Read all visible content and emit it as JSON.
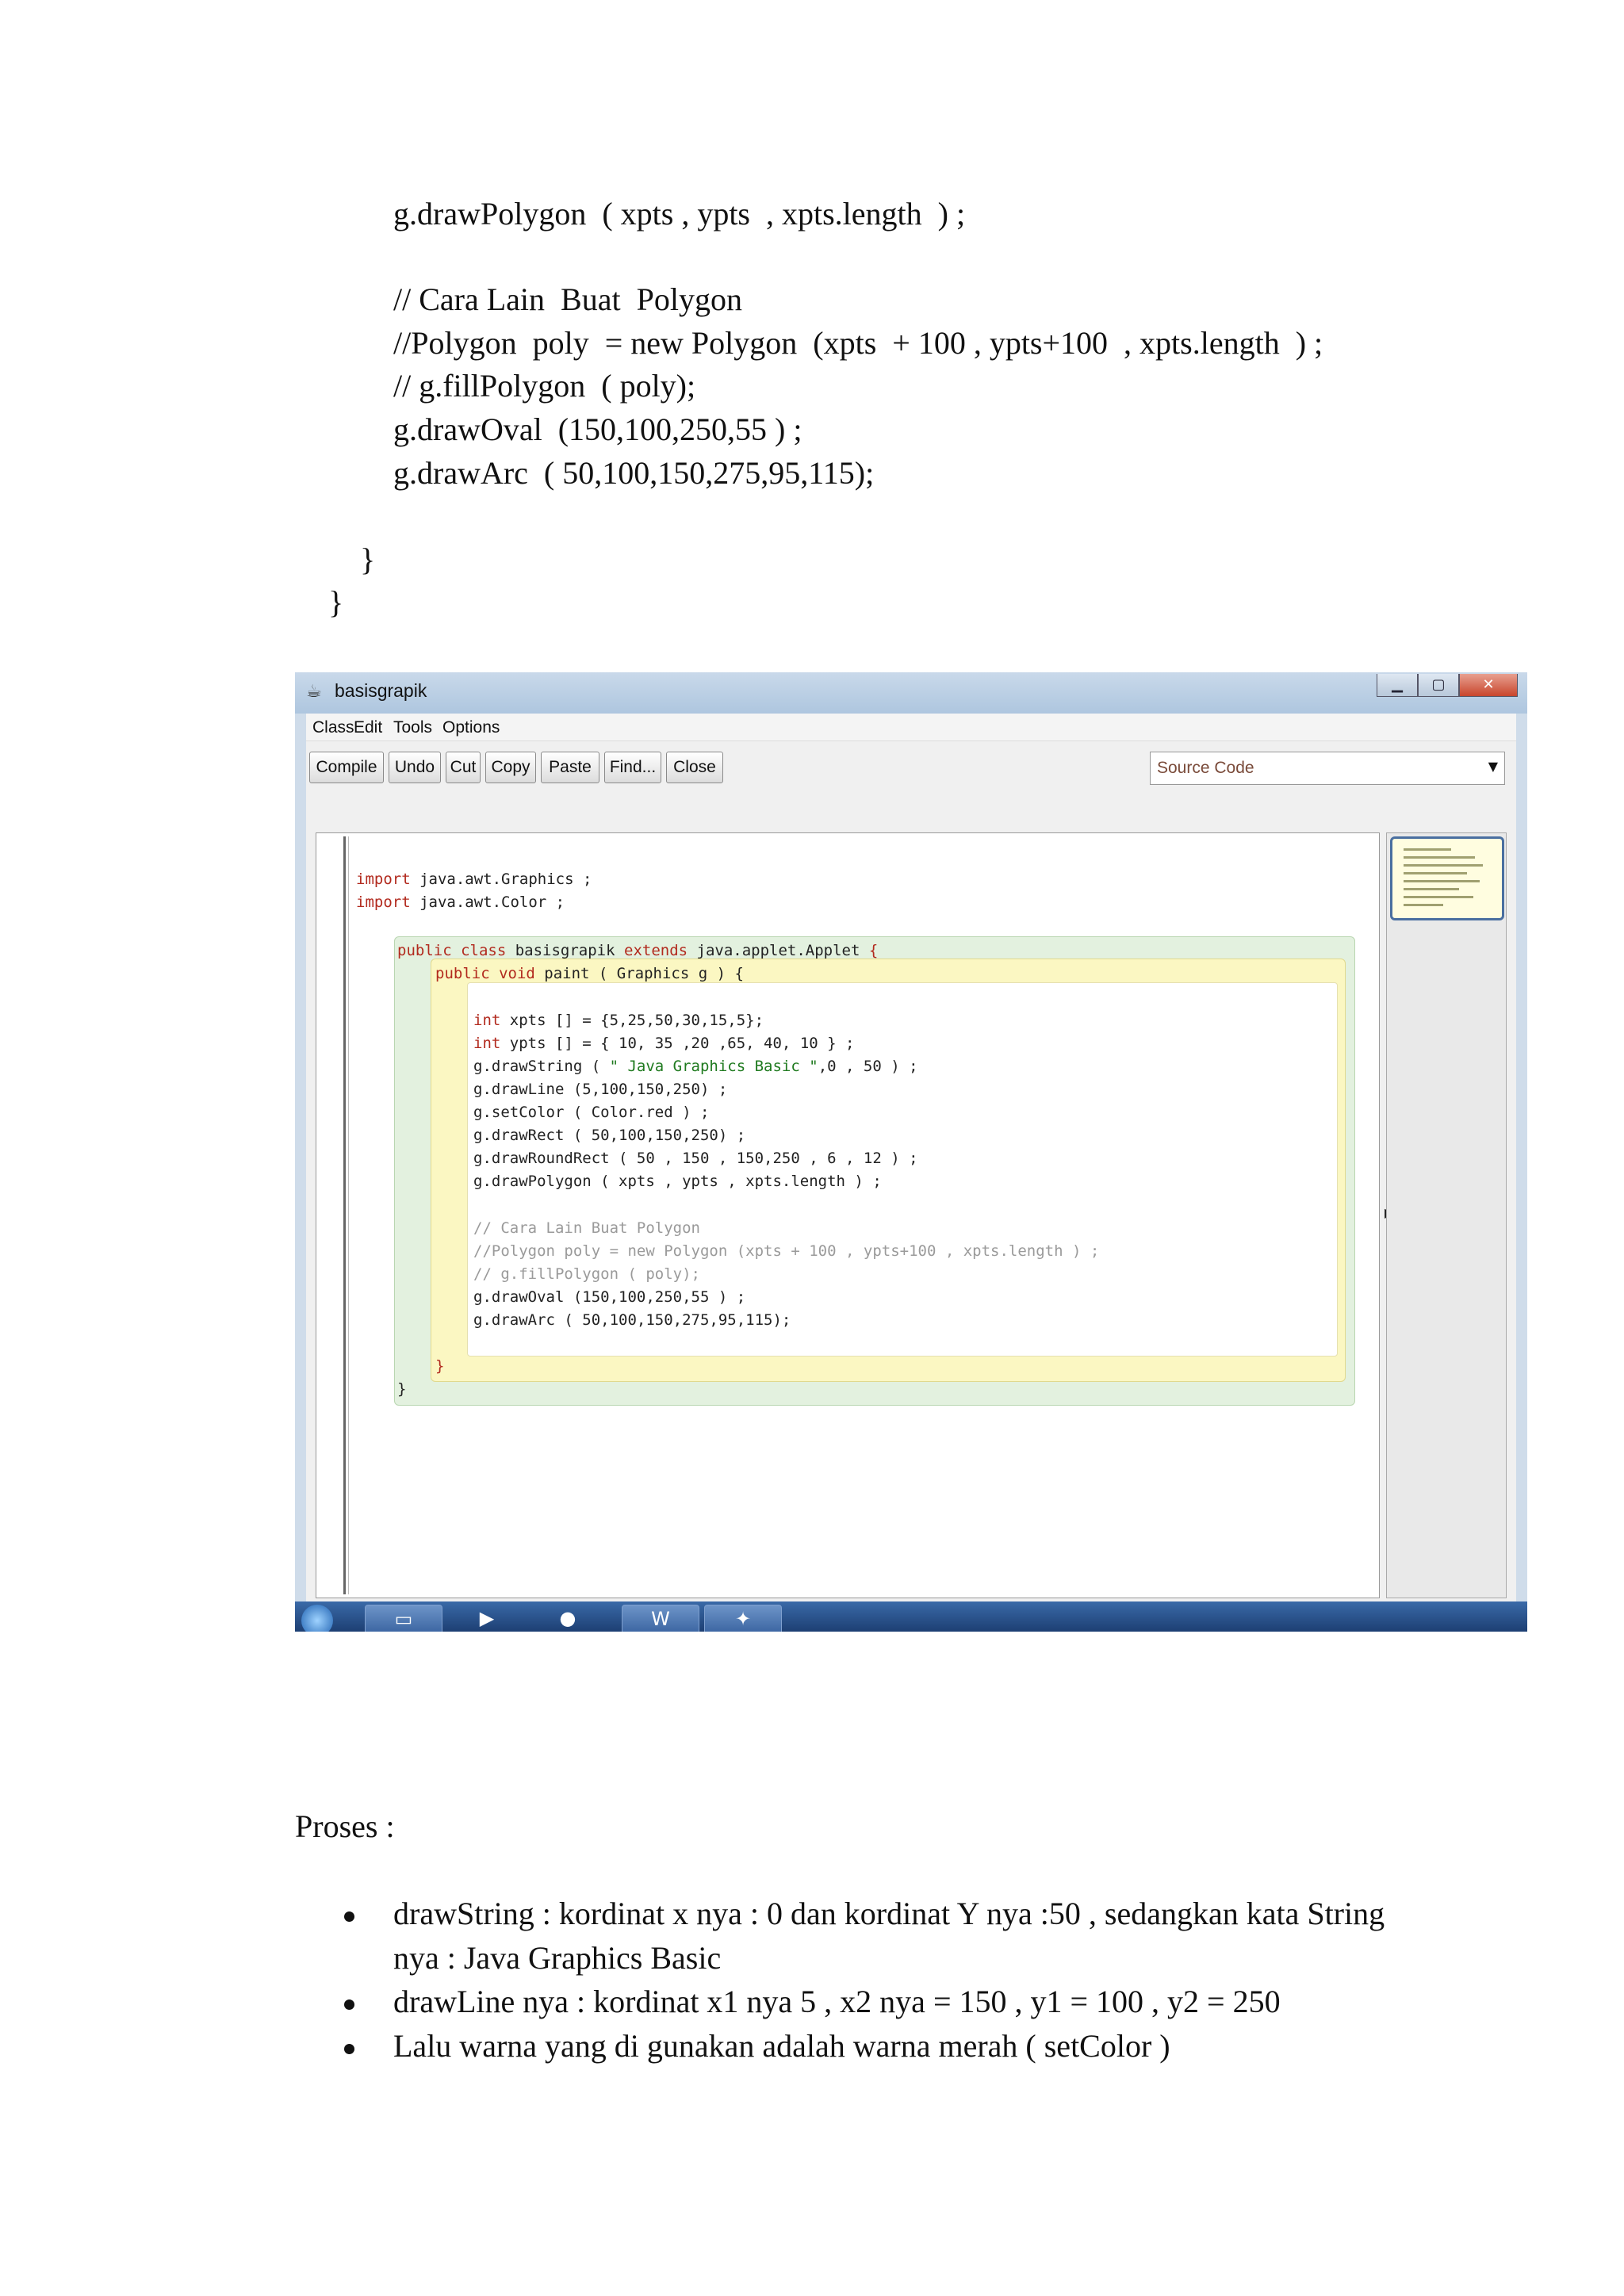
{
  "code_lines": [
    "g.drawPolygon  ( xpts , ypts  , xpts.length  ) ;",
    "// Cara Lain  Buat  Polygon",
    "//Polygon  poly  = new Polygon  (xpts  + 100 , ypts+100  , xpts.length  ) ;",
    "// g.fillPolygon  ( poly);",
    "g.drawOval  (150,100,250,55 ) ;",
    "g.drawArc  ( 50,100,150,275,95,115);",
    "}",
    "}"
  ],
  "window": {
    "title": "basisgrapik",
    "menu": [
      "Class",
      "Edit",
      "Tools",
      "Options"
    ],
    "toolbar": [
      "Compile",
      "Undo",
      "Cut",
      "Copy",
      "Paste",
      "Find...",
      "Close"
    ],
    "view_select": "Source Code",
    "status_saved": "saved",
    "icons": {
      "app": "java-cup-icon",
      "start": "windows-start-icon"
    }
  },
  "editor": {
    "import1_kw": "import",
    "import1_rest": " java.awt.Graphics ;",
    "import2_kw": "import",
    "import2_rest": " java.awt.Color ;",
    "class_kw1": "public class",
    "class_name": " basisgrapik ",
    "class_kw2": "extends",
    "class_rest": " java.applet.Applet ",
    "class_brace": "{",
    "method_kw": "public void",
    "method_rest": " paint ( Graphics g ) {",
    "line_xpts_kw": "int",
    "line_xpts_rest": " xpts [] = {5,25,50,30,15,5};",
    "line_ypts_kw": "int",
    "line_ypts_rest": " ypts [] = { 10, 35 ,20 ,65, 40, 10 } ;",
    "line_drawstring_a": "g.drawString ( ",
    "line_drawstring_str": "\" Java Graphics Basic \"",
    "line_drawstring_b": ",0 , 50 ) ;",
    "line_drawline": "g.drawLine (5,100,150,250) ;",
    "line_setcolor": "g.setColor ( Color.red ) ;",
    "line_drawrect": "g.drawRect ( 50,100,150,250) ;",
    "line_roundrect": "g.drawRoundRect ( 50 , 150 , 150,250 , 6 , 12 ) ;",
    "line_polygon": "g.drawPolygon ( xpts , ypts , xpts.length ) ;",
    "line_cmt1": "// Cara Lain Buat Polygon",
    "line_cmt2": "//Polygon poly = new Polygon (xpts + 100 , ypts+100 , xpts.length ) ;",
    "line_cmt3": "// g.fillPolygon ( poly);",
    "line_oval": "g.drawOval (150,100,250,55 ) ;",
    "line_arc": "g.drawArc ( 50,100,150,275,95,115);",
    "close_method": "}",
    "close_class": "}"
  },
  "proses": {
    "heading": "Proses :",
    "bullets": [
      "drawString   : kordinat  x nya  : 0 dan kordinat  Y nya  :50 , sedangkan  kata String",
      "nya  : Java Graphics  Basic",
      "drawLine  nya  : kordinat  x1 nya  5 , x2 nya  = 150 , y1 = 100 , y2 = 250",
      "Lalu  warna  yang  di gunakan  adalah  warna  merah  ( setColor  )"
    ]
  }
}
